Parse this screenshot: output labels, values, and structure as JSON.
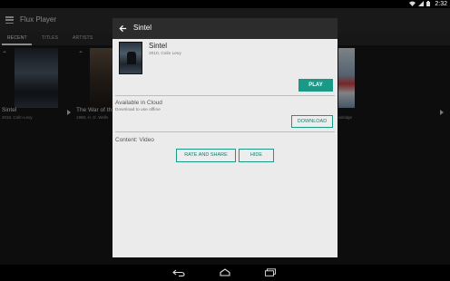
{
  "status_bar": {
    "time": "2:32",
    "icons": [
      "wifi-icon",
      "signal-icon",
      "battery-icon"
    ]
  },
  "app": {
    "title": "Flux Player",
    "tabs": [
      {
        "label": "RECENT",
        "active": true
      },
      {
        "label": "TITLES",
        "active": false
      },
      {
        "label": "ARTISTS",
        "active": false
      }
    ]
  },
  "tiles": [
    {
      "title": "Sintel",
      "subtitle": "2010, Colin Levy",
      "poster_color": "#3b4652"
    },
    {
      "title": "The War of th",
      "subtitle": "1988, H. G. Wells",
      "poster_color": "#4a3e33"
    },
    {
      "title": "",
      "subtitle": "",
      "poster_color": "#5a6a80"
    },
    {
      "title": "",
      "subtitle": "",
      "poster_color": "#5a7fb0"
    },
    {
      "title": "",
      "subtitle": "ubridge",
      "poster_color": "#c8d6e2"
    }
  ],
  "dialog": {
    "title": "Sintel",
    "movie_title": "Sintel",
    "movie_subtitle": "2010, Colin Levy",
    "play_label": "PLAY",
    "cloud_title": "Available in Cloud",
    "cloud_subtitle": "Download to use offline",
    "download_label": "DOWNLOAD",
    "content_label": "Content: Video",
    "rate_share_label": "RATE AND SHARE",
    "hide_label": "HIDE"
  },
  "colors": {
    "accent": "#1a9986",
    "app_bar": "#2e2e2e",
    "dialog_bg": "#ebebeb"
  },
  "nav_bar": {
    "icons": [
      "back-icon",
      "home-icon",
      "recent-apps-icon"
    ]
  }
}
